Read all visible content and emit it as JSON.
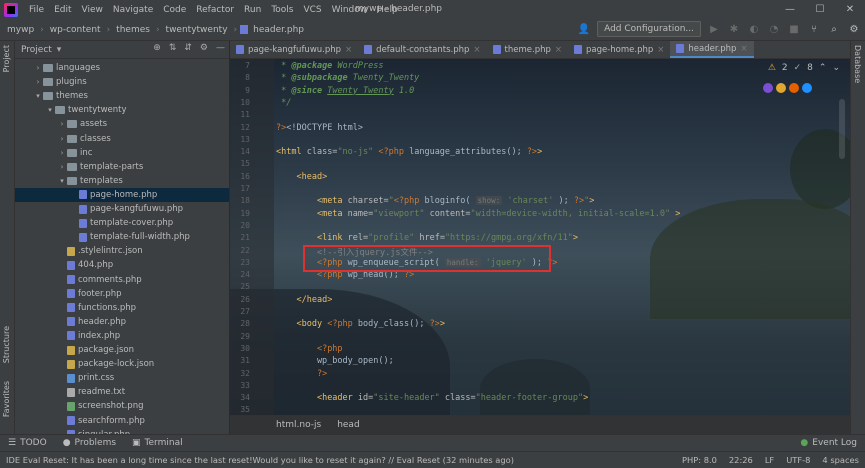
{
  "window": {
    "title": "mywp - header.php",
    "menu": [
      "File",
      "Edit",
      "View",
      "Navigate",
      "Code",
      "Refactor",
      "Run",
      "Tools",
      "VCS",
      "Window",
      "Help"
    ],
    "controls": [
      "—",
      "☐",
      "✕"
    ]
  },
  "navbar": {
    "breadcrumb": [
      "mywp",
      "wp-content",
      "themes",
      "twentytwenty",
      "header.php"
    ],
    "add_configuration": "Add Configuration..."
  },
  "sidebar_left": {
    "project_label": "Project",
    "structure_label": "Structure",
    "favorites_label": "Favorites"
  },
  "sidebar_right": {
    "database_label": "Database"
  },
  "project": {
    "title": "Project",
    "tree": [
      {
        "label": "languages",
        "type": "folder",
        "depth": 2,
        "expanded": false
      },
      {
        "label": "plugins",
        "type": "folder",
        "depth": 2,
        "expanded": false
      },
      {
        "label": "themes",
        "type": "folder",
        "depth": 2,
        "expanded": true
      },
      {
        "label": "twentytwenty",
        "type": "folder",
        "depth": 3,
        "expanded": true
      },
      {
        "label": "assets",
        "type": "folder",
        "depth": 4,
        "expanded": false
      },
      {
        "label": "classes",
        "type": "folder",
        "depth": 4,
        "expanded": false
      },
      {
        "label": "inc",
        "type": "folder",
        "depth": 4,
        "expanded": false
      },
      {
        "label": "template-parts",
        "type": "folder",
        "depth": 4,
        "expanded": false
      },
      {
        "label": "templates",
        "type": "folder",
        "depth": 4,
        "expanded": true
      },
      {
        "label": "page-home.php",
        "type": "php",
        "depth": 5,
        "selected": true
      },
      {
        "label": "page-kangfufuwu.php",
        "type": "php",
        "depth": 5
      },
      {
        "label": "template-cover.php",
        "type": "php",
        "depth": 5
      },
      {
        "label": "template-full-width.php",
        "type": "php",
        "depth": 5
      },
      {
        "label": ".stylelintrc.json",
        "type": "json",
        "depth": 4
      },
      {
        "label": "404.php",
        "type": "php",
        "depth": 4
      },
      {
        "label": "comments.php",
        "type": "php",
        "depth": 4
      },
      {
        "label": "footer.php",
        "type": "php",
        "depth": 4
      },
      {
        "label": "functions.php",
        "type": "php",
        "depth": 4
      },
      {
        "label": "header.php",
        "type": "php",
        "depth": 4
      },
      {
        "label": "index.php",
        "type": "php",
        "depth": 4
      },
      {
        "label": "package.json",
        "type": "json",
        "depth": 4
      },
      {
        "label": "package-lock.json",
        "type": "json",
        "depth": 4
      },
      {
        "label": "print.css",
        "type": "css",
        "depth": 4
      },
      {
        "label": "readme.txt",
        "type": "txt",
        "depth": 4
      },
      {
        "label": "screenshot.png",
        "type": "png",
        "depth": 4
      },
      {
        "label": "searchform.php",
        "type": "php",
        "depth": 4
      },
      {
        "label": "singular.php",
        "type": "php",
        "depth": 4
      }
    ]
  },
  "tabs": [
    {
      "label": "page-kangfufuwu.php",
      "active": false
    },
    {
      "label": "default-constants.php",
      "active": false
    },
    {
      "label": "theme.php",
      "active": false
    },
    {
      "label": "page-home.php",
      "active": false
    },
    {
      "label": "header.php",
      "active": true
    }
  ],
  "inspections": {
    "warnings": "2",
    "weak": "8"
  },
  "editor": {
    "lines": [
      {
        "n": "7",
        "html": "<span class='cmt'> * <b>@package</b> WordPress</span>"
      },
      {
        "n": "8",
        "html": "<span class='cmt'> * <b>@subpackage</b> Twenty_Twenty</span>"
      },
      {
        "n": "9",
        "html": "<span class='cmt'> * <b>@since</b> <u>Twenty Twenty</u> 1.0</span>"
      },
      {
        "n": "10",
        "html": "<span class='cmt'> */</span>"
      },
      {
        "n": "11",
        "html": ""
      },
      {
        "n": "12",
        "html": "<span class='php-t'>?&gt;</span>&lt;!DOCTYPE html&gt;"
      },
      {
        "n": "13",
        "html": ""
      },
      {
        "n": "14",
        "html": "<span class='tag'>&lt;html</span> <span class='attr'>class=</span><span class='str'>\"no-js\"</span> <span class='php-t'>&lt;?php</span> language_attributes(); <span class='php-t'>?&gt;</span><span class='tag'>&gt;</span>"
      },
      {
        "n": "15",
        "html": ""
      },
      {
        "n": "16",
        "html": "    <span class='tag'>&lt;head&gt;</span>"
      },
      {
        "n": "17",
        "html": ""
      },
      {
        "n": "18",
        "html": "        <span class='tag'>&lt;meta</span> <span class='attr'>charset=</span><span class='str'>\"</span><span class='php-t'>&lt;?php</span> bloginfo( <span class='hint'>show:</span> <span class='str'>'charset'</span> ); <span class='php-t'>?&gt;</span><span class='str'>\"</span><span class='tag'>&gt;</span>"
      },
      {
        "n": "19",
        "html": "        <span class='tag'>&lt;meta</span> <span class='attr'>name=</span><span class='str'>\"viewport\"</span> <span class='attr'>content=</span><span class='str'>\"width=device-width, initial-scale=1.0\"</span> <span class='tag'>&gt;</span>"
      },
      {
        "n": "20",
        "html": ""
      },
      {
        "n": "21",
        "html": "        <span class='tag'>&lt;link</span> <span class='attr'>rel=</span><span class='str'>\"profile\"</span> <span class='attr'>href=</span><span class='str'>\"https://gmpg.org/xfn/11\"</span><span class='tag'>&gt;</span>"
      },
      {
        "n": "22",
        "html": "        <span class='htmlcmt'>&lt;!--引入jquery.js文件--&gt;</span>"
      },
      {
        "n": "23",
        "html": "        <span class='php-t'>&lt;?php</span> wp_enqueue_script( <span class='hint'>handle:</span> <span class='str'>'jquery'</span> ); <span class='php-t'>?&gt;</span>"
      },
      {
        "n": "24",
        "html": "        <span class='php-t'>&lt;?php</span> wp_head(); <span class='php-t'>?&gt;</span>"
      },
      {
        "n": "25",
        "html": ""
      },
      {
        "n": "26",
        "html": "    <span class='tag'>&lt;/head&gt;</span>"
      },
      {
        "n": "27",
        "html": ""
      },
      {
        "n": "28",
        "html": "    <span class='tag'>&lt;body</span> <span class='php-t'>&lt;?php</span> body_class(); <span class='php-t'>?&gt;</span><span class='tag'>&gt;</span>"
      },
      {
        "n": "29",
        "html": ""
      },
      {
        "n": "30",
        "html": "        <span class='php-t'>&lt;?php</span>"
      },
      {
        "n": "31",
        "html": "        wp_body_open();"
      },
      {
        "n": "32",
        "html": "        <span class='php-t'>?&gt;</span>"
      },
      {
        "n": "33",
        "html": ""
      },
      {
        "n": "34",
        "html": "        <span class='tag'>&lt;header</span> <span class='attr'>id=</span><span class='str'>\"site-header\"</span> <span class='attr'>class=</span><span class='str'>\"header-footer-group\"</span><span class='tag'>&gt;</span>"
      },
      {
        "n": "35",
        "html": ""
      }
    ]
  },
  "editor_breadcrumb": [
    "html.no-js",
    "head"
  ],
  "bottom_tools": [
    {
      "label": "TODO",
      "icon": "list-icon"
    },
    {
      "label": "Problems",
      "icon": "info-icon"
    },
    {
      "label": "Terminal",
      "icon": "terminal-icon"
    }
  ],
  "event_log": "Event Log",
  "status": {
    "message": "IDE Eval Reset: It has been a long time since the last reset!Would you like to reset it again? // Eval Reset (32 minutes ago)",
    "php": "PHP: 8.0",
    "position": "22:26",
    "line_sep": "LF",
    "encoding": "UTF-8",
    "indent": "4 spaces"
  }
}
